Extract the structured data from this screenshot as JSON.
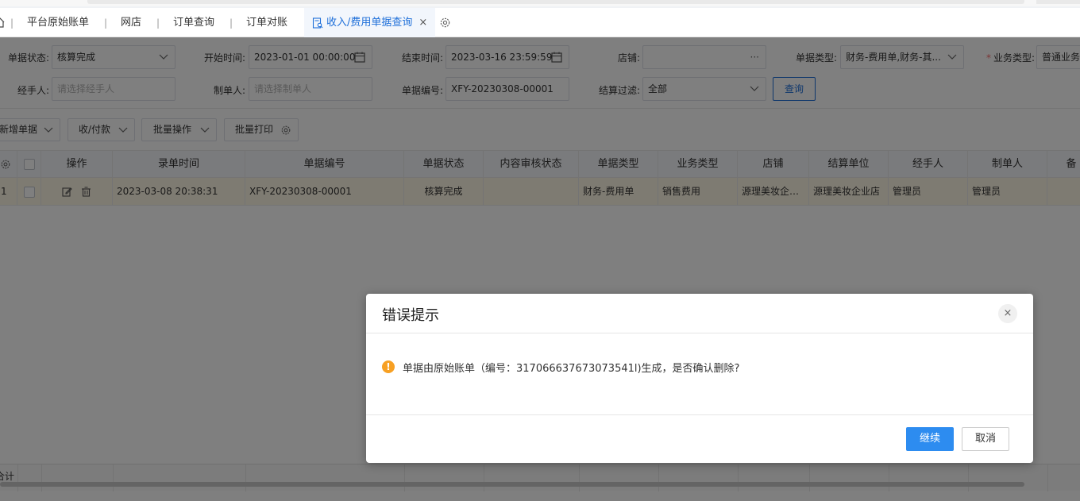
{
  "tabs": [
    {
      "label": "平台原始账单"
    },
    {
      "label": "网店"
    },
    {
      "label": "订单查询"
    },
    {
      "label": "订单对账"
    },
    {
      "label": "收入/费用单据查询",
      "active": true
    }
  ],
  "tab_separator": "|",
  "tab_close": "×",
  "filters": {
    "status_label": "单据状态:",
    "status_value": "核算完成",
    "start_label": "开始时间:",
    "start_value": "2023-01-01 00:00:00",
    "end_label": "结束时间:",
    "end_value": "2023-03-16 23:59:59",
    "shop_label": "店铺:",
    "shop_value": "",
    "shop_more": "···",
    "doc_type_label": "单据类型:",
    "doc_type_value": "财务-费用单,财务-其...",
    "biz_type_required": "*",
    "biz_type_label": "业务类型:",
    "biz_type_value": "普通业务",
    "handler_label": "经手人:",
    "handler_placeholder": "请选择经手人",
    "maker_label": "制单人:",
    "maker_placeholder": "请选择制单人",
    "doc_no_label": "单据编号:",
    "doc_no_value": "XFY-20230308-00001",
    "settle_label": "结算过滤:",
    "settle_value": "全部",
    "query_button": "查询"
  },
  "actions": [
    {
      "label": "新增单据"
    },
    {
      "label": "收/付款"
    },
    {
      "label": "批量操作"
    },
    {
      "label": "批量打印"
    }
  ],
  "table": {
    "headers": [
      "操作",
      "录单时间",
      "单据编号",
      "单据状态",
      "内容审核状态",
      "单据类型",
      "业务类型",
      "店铺",
      "结算单位",
      "经手人",
      "制单人",
      "备"
    ],
    "rows": [
      {
        "index": "1",
        "time": "2023-03-08 20:38:31",
        "doc_no": "XFY-20230308-00001",
        "status": "核算完成",
        "review_status": "",
        "doc_type": "财务-费用单",
        "biz_type": "销售费用",
        "shop": "源理美妆企业店",
        "settle_unit": "源理美妆企业店",
        "handler": "管理员",
        "maker": "管理员"
      }
    ],
    "footer_label": "合计"
  },
  "dialog": {
    "title": "错误提示",
    "close": "×",
    "warn_symbol": "!",
    "message": "单据由原始账单（编号：317066637673073541l)生成，是否确认删除?",
    "ok_label": "继续",
    "cancel_label": "取消"
  }
}
